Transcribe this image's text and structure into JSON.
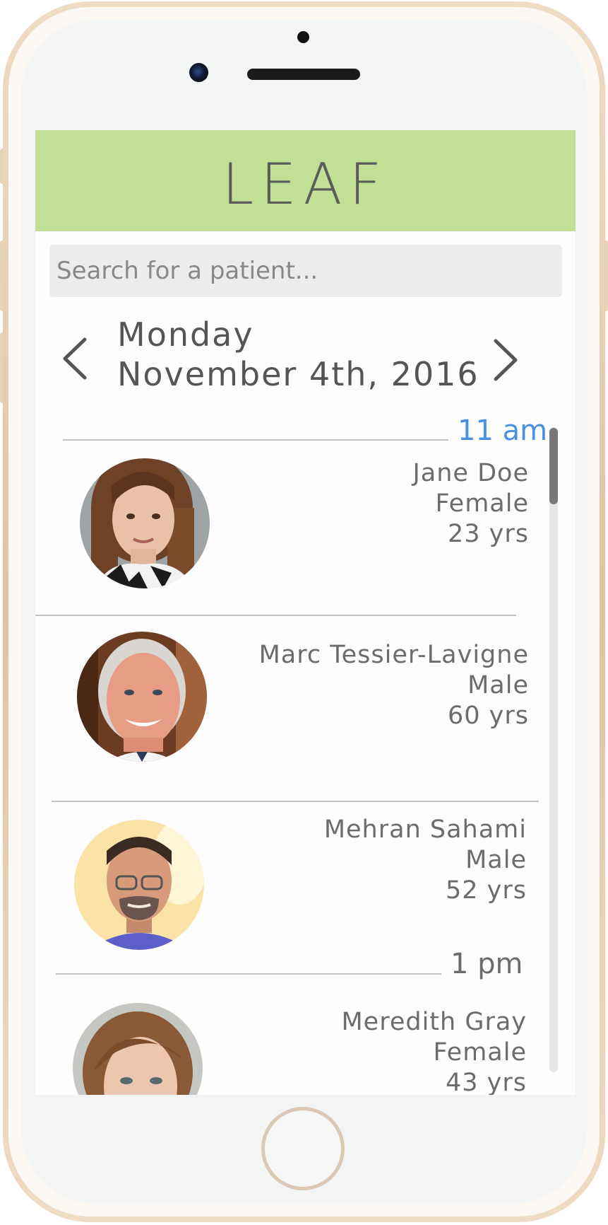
{
  "app": {
    "logo": "LEAF"
  },
  "search": {
    "placeholder": "Search for a patient..."
  },
  "date_nav": {
    "day": "Monday",
    "date": "November 4th, 2016"
  },
  "timeslots": [
    {
      "label": "11 am",
      "color": "#4a90e2"
    },
    {
      "label": "1 pm",
      "color": "#6c6c6c"
    }
  ],
  "patients": [
    {
      "name": "Jane Doe",
      "sex": "Female",
      "age": "23 yrs"
    },
    {
      "name": "Marc Tessier-Lavigne",
      "sex": "Male",
      "age": "60 yrs"
    },
    {
      "name": "Mehran Sahami",
      "sex": "Male",
      "age": "52 yrs"
    },
    {
      "name": "Meredith Gray",
      "sex": "Female",
      "age": "43 yrs"
    }
  ],
  "colors": {
    "header": "#c1e095",
    "accent_time": "#4a90e2",
    "text": "#6c6c6c"
  }
}
